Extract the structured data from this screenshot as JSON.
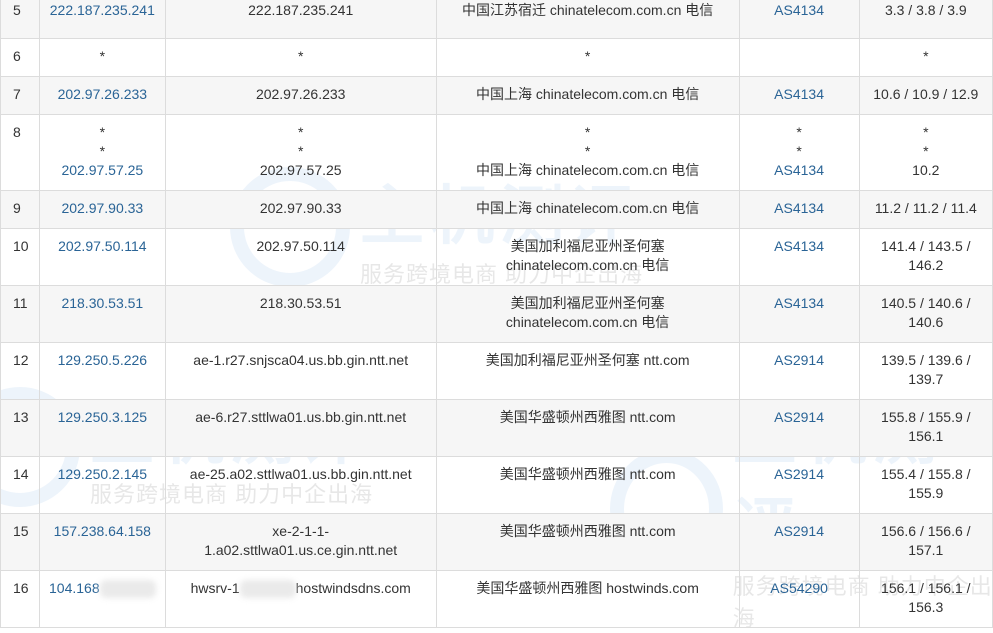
{
  "rows": [
    {
      "hop": "5",
      "ip": "222.187.235.241",
      "host": "222.187.235.241",
      "loc": [
        "中国江苏宿迁 chinatelecom.com.cn 电信"
      ],
      "asn": "AS4134",
      "rtt": [
        "3.3 / 3.8 / 3.9"
      ],
      "stars": false
    },
    {
      "hop": "6",
      "ip": "*",
      "host": "*",
      "loc": [
        "*"
      ],
      "asn": "",
      "rtt": [
        "*"
      ],
      "stars": true
    },
    {
      "hop": "7",
      "ip": "202.97.26.233",
      "host": "202.97.26.233",
      "loc": [
        "中国上海 chinatelecom.com.cn 电信"
      ],
      "asn": "AS4134",
      "rtt": [
        "10.6 / 10.9 / 12.9"
      ],
      "stars": false
    },
    {
      "hop": "8",
      "ip": "202.97.57.25",
      "host": "202.97.57.25",
      "loc": [
        "中国上海 chinatelecom.com.cn 电信"
      ],
      "asn": "AS4134",
      "rtt": [
        "10.2"
      ],
      "stars": false,
      "multi": true
    },
    {
      "hop": "9",
      "ip": "202.97.90.33",
      "host": "202.97.90.33",
      "loc": [
        "中国上海 chinatelecom.com.cn 电信"
      ],
      "asn": "AS4134",
      "rtt": [
        "11.2 / 11.2 / 11.4"
      ],
      "stars": false
    },
    {
      "hop": "10",
      "ip": "202.97.50.114",
      "host": "202.97.50.114",
      "loc": [
        "美国加利福尼亚州圣何塞",
        "chinatelecom.com.cn 电信"
      ],
      "asn": "AS4134",
      "rtt": [
        "141.4 / 143.5 /",
        "146.2"
      ],
      "stars": false
    },
    {
      "hop": "11",
      "ip": "218.30.53.51",
      "host": "218.30.53.51",
      "loc": [
        "美国加利福尼亚州圣何塞",
        "chinatelecom.com.cn 电信"
      ],
      "asn": "AS4134",
      "rtt": [
        "140.5 / 140.6 /",
        "140.6"
      ],
      "stars": false
    },
    {
      "hop": "12",
      "ip": "129.250.5.226",
      "host": "ae-1.r27.snjsca04.us.bb.gin.ntt.net",
      "loc": [
        "美国加利福尼亚州圣何塞 ntt.com"
      ],
      "asn": "AS2914",
      "rtt": [
        "139.5 / 139.6 /",
        "139.7"
      ],
      "stars": false
    },
    {
      "hop": "13",
      "ip": "129.250.3.125",
      "host": "ae-6.r27.sttlwa01.us.bb.gin.ntt.net",
      "loc": [
        "美国华盛顿州西雅图 ntt.com"
      ],
      "asn": "AS2914",
      "rtt": [
        "155.8 / 155.9 /",
        "156.1"
      ],
      "stars": false
    },
    {
      "hop": "14",
      "ip": "129.250.2.145",
      "host": "ae-25.a02.sttlwa01.us.bb.gin.ntt.net",
      "loc": [
        "美国华盛顿州西雅图 ntt.com"
      ],
      "asn": "AS2914",
      "rtt": [
        "155.4 / 155.8 /",
        "155.9"
      ],
      "stars": false
    },
    {
      "hop": "15",
      "ip": "157.238.64.158",
      "host": "xe-2-1-1-\n1.a02.sttlwa01.us.ce.gin.ntt.net",
      "loc": [
        "美国华盛顿州西雅图 ntt.com"
      ],
      "asn": "AS2914",
      "rtt": [
        "156.6 / 156.6 /",
        "157.1"
      ],
      "stars": false
    },
    {
      "hop": "16",
      "ip": "104.168",
      "host": "hwsrv-1",
      "host_suffix": "hostwindsdns.com",
      "loc": [
        "美国华盛顿州西雅图 hostwinds.com"
      ],
      "asn": "AS54290",
      "rtt": [
        "156.1 / 156.1 /",
        "156.3"
      ],
      "stars": false,
      "blurred": true
    }
  ],
  "watermark": {
    "brand": "主机测评",
    "slogan": "服务跨境电商 助力中企出海"
  }
}
